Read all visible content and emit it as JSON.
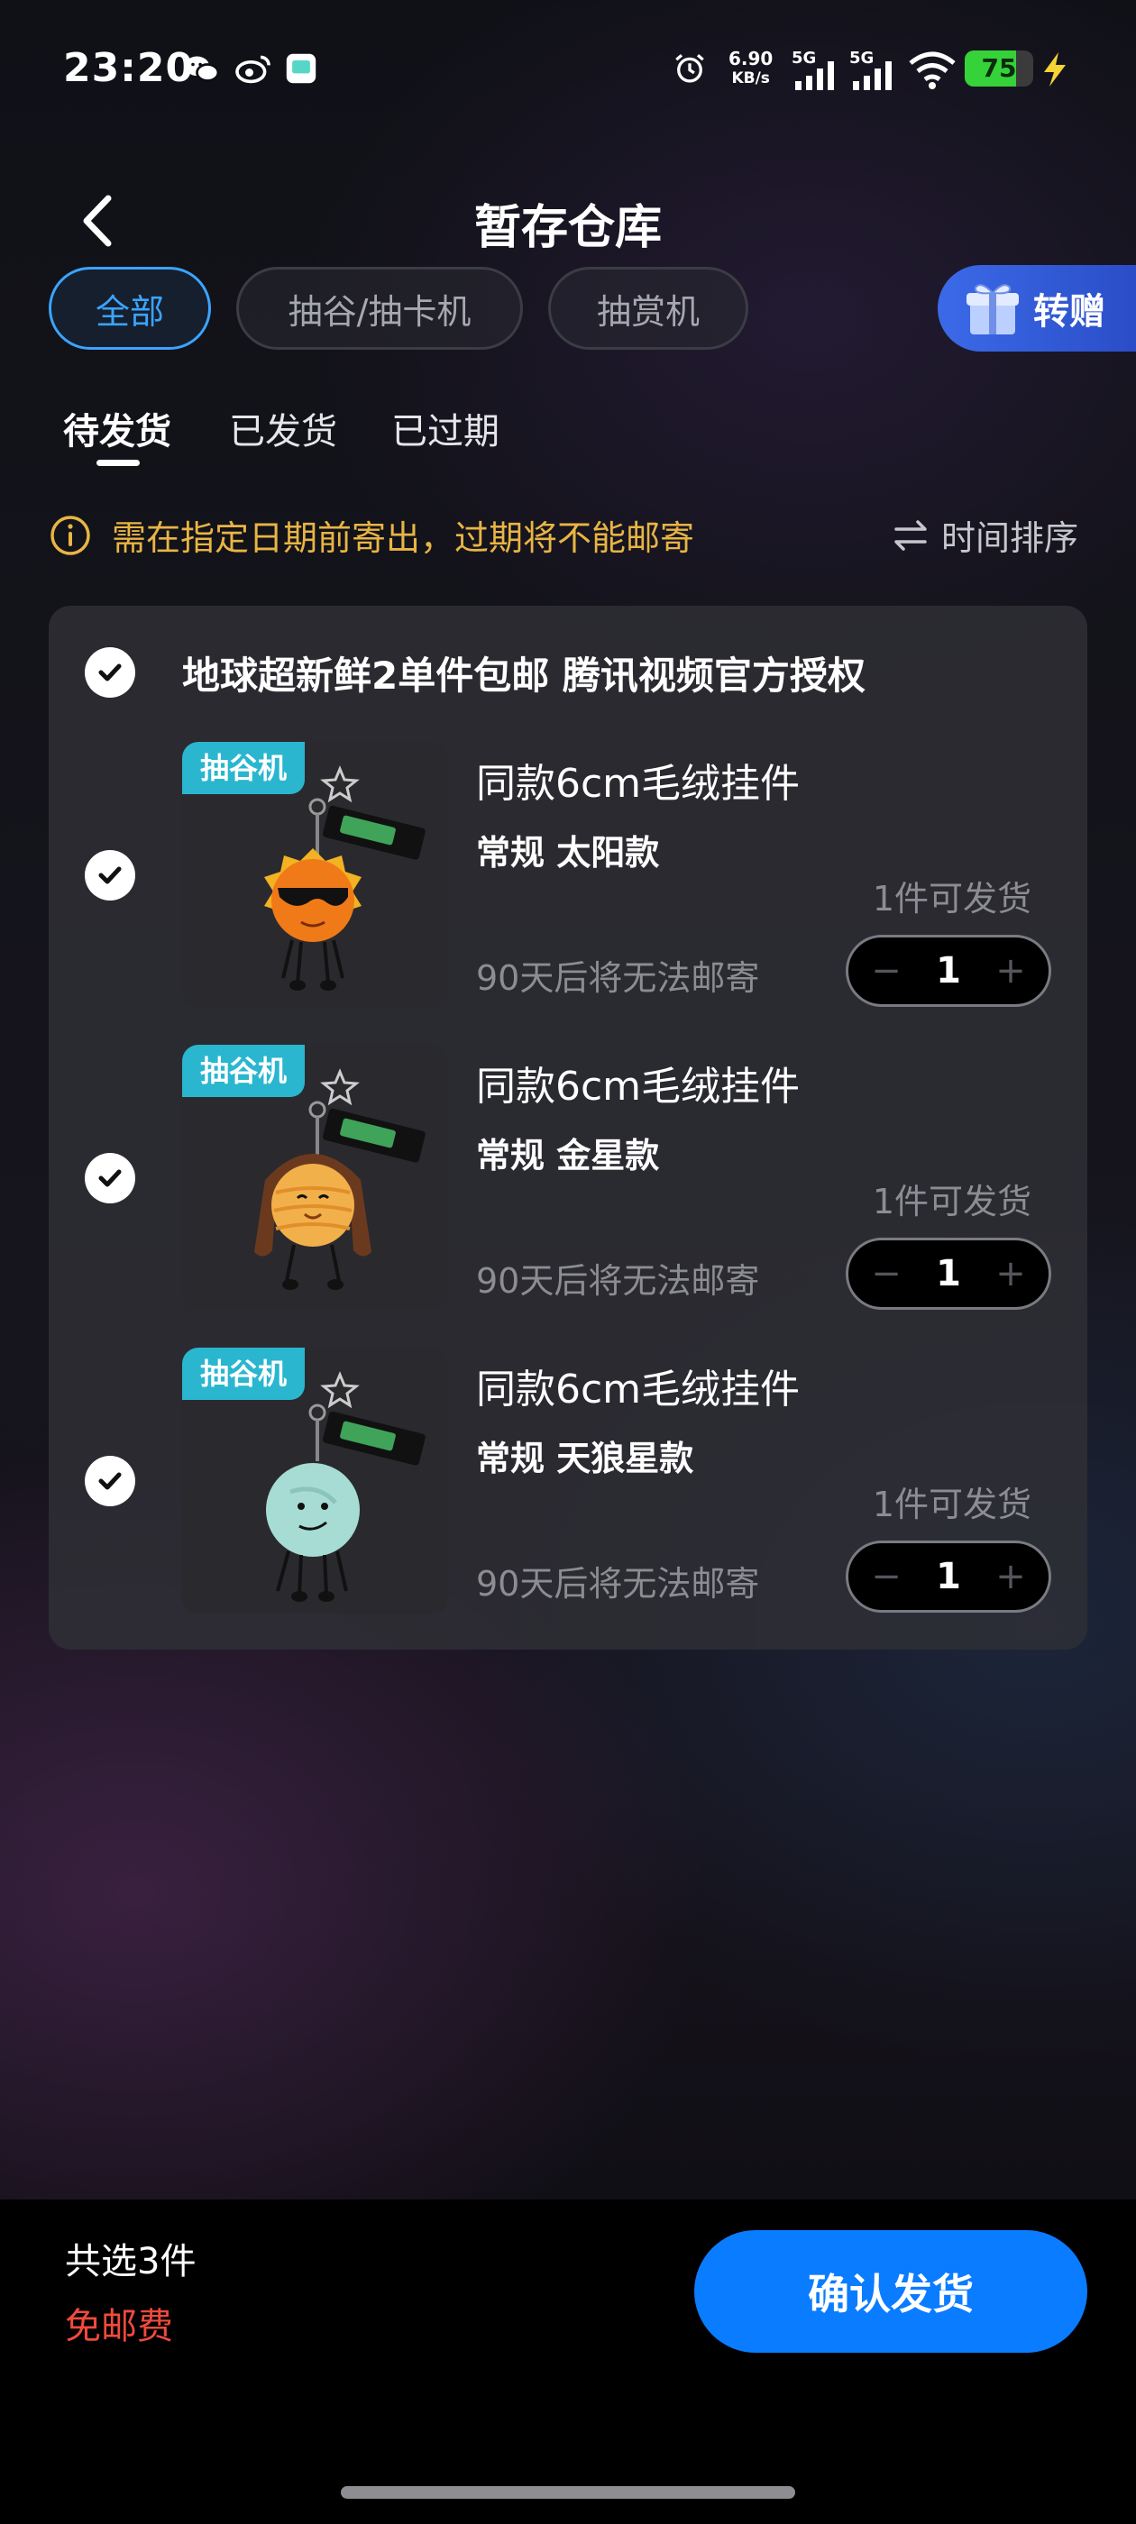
{
  "status_bar": {
    "time": "23:20",
    "net_speed_value": "6.90",
    "net_speed_unit": "KB/s",
    "signal1_label": "5G",
    "signal2_label": "5G",
    "battery_level": 75,
    "battery_text": "75",
    "icons": [
      "wechat-icon",
      "weibo-icon",
      "app-icon",
      "alarm-icon",
      "wifi-icon",
      "charging-icon"
    ]
  },
  "header": {
    "title": "暂存仓库"
  },
  "filters": {
    "chips": [
      {
        "label": "全部",
        "active": true
      },
      {
        "label": "抽谷/抽卡机",
        "active": false
      },
      {
        "label": "抽赏机",
        "active": false
      }
    ],
    "gift_label": "转赠"
  },
  "tabs": [
    {
      "label": "待发货",
      "active": true
    },
    {
      "label": "已发货",
      "active": false
    },
    {
      "label": "已过期",
      "active": false
    }
  ],
  "notice": {
    "text": "需在指定日期前寄出，过期将不能邮寄",
    "sort_label": "时间排序"
  },
  "order": {
    "shop_title": "地球超新鲜2单件包邮 腾讯视频官方授权",
    "items": [
      {
        "tag": "抽谷机",
        "name": "同款6cm毛绒挂件",
        "spec": "常规 太阳款",
        "stock": "1件可发货",
        "warning": "90天后将无法邮寄",
        "qty": "1",
        "minus": "−",
        "plus": "+",
        "image": "sun-plush"
      },
      {
        "tag": "抽谷机",
        "name": "同款6cm毛绒挂件",
        "spec": "常规 金星款",
        "stock": "1件可发货",
        "warning": "90天后将无法邮寄",
        "qty": "1",
        "minus": "−",
        "plus": "+",
        "image": "venus-plush"
      },
      {
        "tag": "抽谷机",
        "name": "同款6cm毛绒挂件",
        "spec": "常规 天狼星款",
        "stock": "1件可发货",
        "warning": "90天后将无法邮寄",
        "qty": "1",
        "minus": "−",
        "plus": "+",
        "image": "sirius-plush"
      }
    ]
  },
  "footer": {
    "selected_count": "共选3件",
    "shipping_fee": "免邮费",
    "confirm_label": "确认发货"
  },
  "colors": {
    "accent": "#0a7cff",
    "chip_active": "#3ba4ff",
    "notice": "#e8b544",
    "fee": "#f04a3d",
    "tag": "#2ab6cf"
  }
}
